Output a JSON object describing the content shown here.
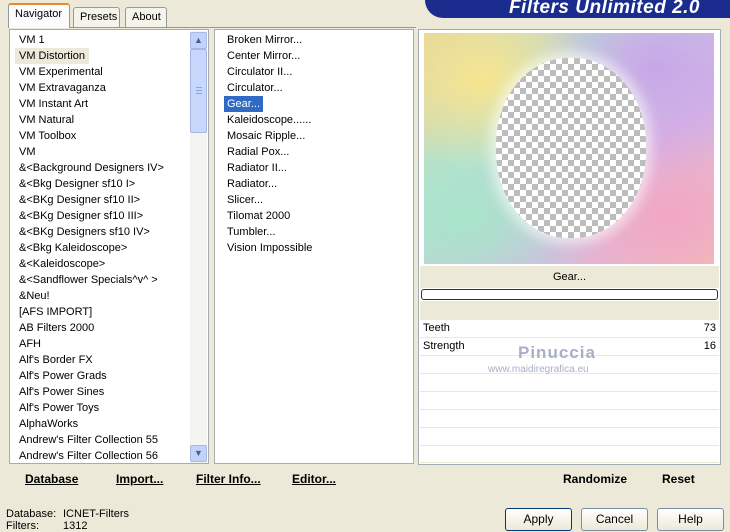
{
  "tabs": [
    "Navigator",
    "Presets",
    "About"
  ],
  "brand": "Filters Unlimited 2.0",
  "categories": [
    "VM 1",
    "VM Distortion",
    "VM Experimental",
    "VM Extravaganza",
    "VM Instant Art",
    "VM Natural",
    "VM Toolbox",
    "VM",
    "&<Background Designers IV>",
    "&<Bkg Designer sf10 I>",
    "&<BKg Designer sf10 II>",
    "&<BKg Designer sf10 III>",
    "&<BKg Designers sf10 IV>",
    "&<Bkg Kaleidoscope>",
    "&<Kaleidoscope>",
    "&<Sandflower Specials^v^ >",
    "&Neu!",
    "[AFS IMPORT]",
    "AB Filters 2000",
    "AFH",
    "Alf's Border FX",
    "Alf's Power Grads",
    "Alf's Power Sines",
    "Alf's Power Toys",
    "AlphaWorks",
    "Andrew's Filter Collection 55",
    "Andrew's Filter Collection 56"
  ],
  "filters": [
    "Broken Mirror...",
    "Center Mirror...",
    "Circulator II...",
    "Circulator...",
    "Gear...",
    "Kaleidoscope......",
    "Mosaic Ripple...",
    "Radial Pox...",
    "Radiator II...",
    "Radiator...",
    "Slicer...",
    "Tilomat 2000",
    "Tumbler...",
    "Vision Impossible"
  ],
  "preview_label": "Gear...",
  "params": [
    {
      "name": "Teeth",
      "value": "73"
    },
    {
      "name": "Strength",
      "value": "16"
    }
  ],
  "watermark": {
    "name": "Pinuccia",
    "url": "www.maidiregrafica.eu"
  },
  "bottom_left": {
    "database": "Database",
    "import": "Import...",
    "filter_info": "Filter Info...",
    "editor": "Editor..."
  },
  "bottom_right": {
    "randomize": "Randomize",
    "reset": "Reset"
  },
  "status": {
    "database_label": "Database:",
    "database_value": "ICNET-Filters",
    "filters_label": "Filters:",
    "filters_value": "1312"
  },
  "buttons": {
    "apply": "Apply",
    "cancel": "Cancel",
    "help": "Help"
  }
}
